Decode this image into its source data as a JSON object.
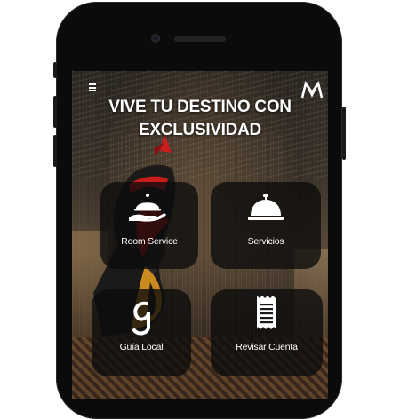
{
  "header": {
    "menu_icon": "hamburger-icon",
    "logo_icon": "brand-logo-mv"
  },
  "hero": {
    "line1": "VIVE TU DESTINO CON",
    "line2": "EXCLUSIVIDAD"
  },
  "tiles": [
    {
      "label": "Room Service",
      "icon": "cloche-hand-icon"
    },
    {
      "label": "Servicios",
      "icon": "service-bell-icon"
    },
    {
      "label": "Guía Local",
      "icon": "guide-g-icon"
    },
    {
      "label": "Revisar Cuenta",
      "icon": "receipt-icon"
    }
  ],
  "colors": {
    "tile_bg": "#0c0c0c",
    "text": "#ffffff",
    "accent_red": "#c81d1d"
  }
}
